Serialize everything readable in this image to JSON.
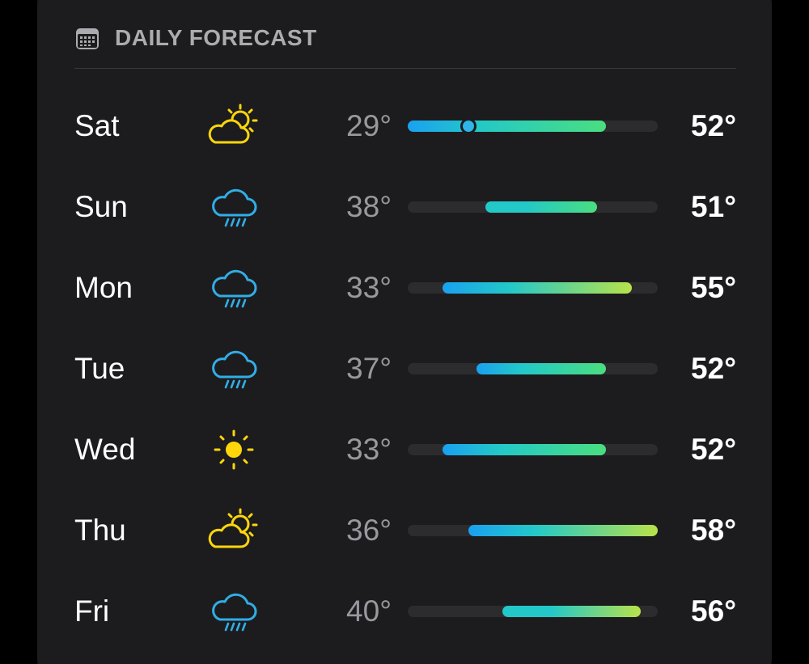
{
  "header": {
    "title": "DAILY FORECAST",
    "icon": "calendar-icon"
  },
  "scale": {
    "min": 29,
    "max": 58
  },
  "colors": {
    "cold": "#1aa1f0",
    "cool": "#23c8c8",
    "mild": "#4ade80",
    "warm": "#b8e24a",
    "sun": "#ffd60a",
    "rain": "#32ade6"
  },
  "days": [
    {
      "day": "Sat",
      "icon": "partly-sunny-icon",
      "low": "29°",
      "high": "52°",
      "low_value": 29,
      "high_value": 52,
      "current_value": 36
    },
    {
      "day": "Sun",
      "icon": "rain-icon",
      "low": "38°",
      "high": "51°",
      "low_value": 38,
      "high_value": 51
    },
    {
      "day": "Mon",
      "icon": "rain-icon",
      "low": "33°",
      "high": "55°",
      "low_value": 33,
      "high_value": 55
    },
    {
      "day": "Tue",
      "icon": "rain-icon",
      "low": "37°",
      "high": "52°",
      "low_value": 37,
      "high_value": 52
    },
    {
      "day": "Wed",
      "icon": "sunny-icon",
      "low": "33°",
      "high": "52°",
      "low_value": 33,
      "high_value": 52
    },
    {
      "day": "Thu",
      "icon": "partly-sunny-icon",
      "low": "36°",
      "high": "58°",
      "low_value": 36,
      "high_value": 58
    },
    {
      "day": "Fri",
      "icon": "rain-icon",
      "low": "40°",
      "high": "56°",
      "low_value": 40,
      "high_value": 56
    }
  ]
}
